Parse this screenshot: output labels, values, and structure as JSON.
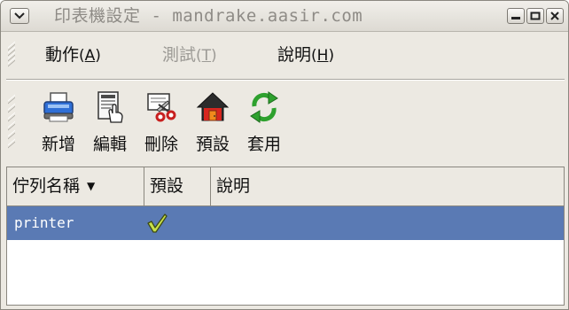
{
  "window": {
    "title": "印表機設定 - mandrake.aasir.com"
  },
  "menubar": {
    "items": [
      {
        "label": "動作",
        "mnemonic_open": "(",
        "mnemonic": "A",
        "mnemonic_close": ")",
        "enabled": true
      },
      {
        "label": "測試",
        "mnemonic_open": "(",
        "mnemonic": "T",
        "mnemonic_close": ")",
        "enabled": false
      },
      {
        "label": "說明",
        "mnemonic_open": "(",
        "mnemonic": "H",
        "mnemonic_close": ")",
        "enabled": true
      }
    ]
  },
  "toolbar": {
    "buttons": [
      {
        "label": "新增",
        "icon": "printer-add-icon"
      },
      {
        "label": "編輯",
        "icon": "edit-document-icon"
      },
      {
        "label": "刪除",
        "icon": "delete-scissors-icon"
      },
      {
        "label": "預設",
        "icon": "home-default-icon"
      },
      {
        "label": "套用",
        "icon": "apply-refresh-icon"
      }
    ]
  },
  "list": {
    "columns": [
      {
        "label": "佇列名稱",
        "sort_icon": "sort-down-arrow-icon"
      },
      {
        "label": "預設"
      },
      {
        "label": "說明"
      }
    ],
    "rows": [
      {
        "queue": "printer",
        "default": "checked",
        "description": "",
        "selected": true
      }
    ]
  },
  "colors": {
    "selection": "#5a7ab4",
    "window_bg": "#ece9e2",
    "title_text": "#8e8b86"
  }
}
